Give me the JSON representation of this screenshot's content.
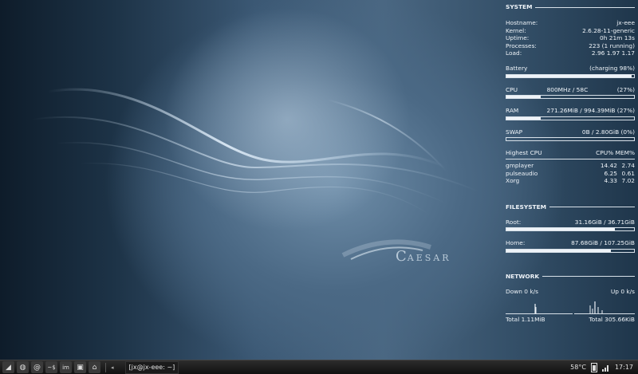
{
  "wallpaper": {
    "logo_c": "C",
    "logo_text": "AESAR"
  },
  "conky": {
    "system": {
      "title": "SYSTEM",
      "hostname_label": "Hostname:",
      "hostname": "jx-eee",
      "kernel_label": "Kernel:",
      "kernel": "2.6.28-11-generic",
      "uptime_label": "Uptime:",
      "uptime": "0h 21m 13s",
      "processes_label": "Processes:",
      "processes": "223 (1 running)",
      "load_label": "Load:",
      "load": "2.96 1.97 1.17",
      "battery_label": "Battery",
      "battery_value": "(charging 98%)",
      "battery_pct": 98,
      "cpu_label": "CPU",
      "cpu_freq": "800MHz / 58C",
      "cpu_value": "(27%)",
      "cpu_pct": 27,
      "ram_label": "RAM",
      "ram_value": "271.26MiB / 994.39MiB (27%)",
      "ram_pct": 27,
      "swap_label": "SWAP",
      "swap_value": "0B / 2.80GiB (0%)",
      "swap_pct": 0,
      "highest_cpu_label": "Highest CPU",
      "highest_cpu_cols": "CPU% MEM%",
      "processes_list": [
        {
          "name": "gmplayer",
          "cpu": "14.42",
          "mem": "2.74"
        },
        {
          "name": "pulseaudio",
          "cpu": "6.25",
          "mem": "0.61"
        },
        {
          "name": "Xorg",
          "cpu": "4.33",
          "mem": "7.02"
        }
      ]
    },
    "filesystem": {
      "title": "FILESYSTEM",
      "root_label": "Root:",
      "root_value": "31.16GiB / 36.71GiB",
      "root_pct": 85,
      "home_label": "Home:",
      "home_value": "87.68GiB / 107.25GiB",
      "home_pct": 82
    },
    "network": {
      "title": "NETWORK",
      "down_label": "Down 0 k/s",
      "up_label": "Up 0 k/s",
      "total_down": "Total 1.11MiB",
      "total_up": "Total 305.66KiB"
    }
  },
  "taskbar": {
    "launchers": [
      {
        "name": "menu-icon",
        "glyph": "◢"
      },
      {
        "name": "globe-icon",
        "glyph": "◍"
      },
      {
        "name": "email-icon",
        "glyph": "@"
      },
      {
        "name": "terminal-icon",
        "glyph": "~$"
      },
      {
        "name": "im-icon",
        "glyph": "im"
      },
      {
        "name": "save-icon",
        "glyph": "▣"
      },
      {
        "name": "home-icon",
        "glyph": "⌂"
      }
    ],
    "task_label": "[jx@jx-eee: ~]",
    "temperature": "58°C",
    "clock": "17:17"
  }
}
